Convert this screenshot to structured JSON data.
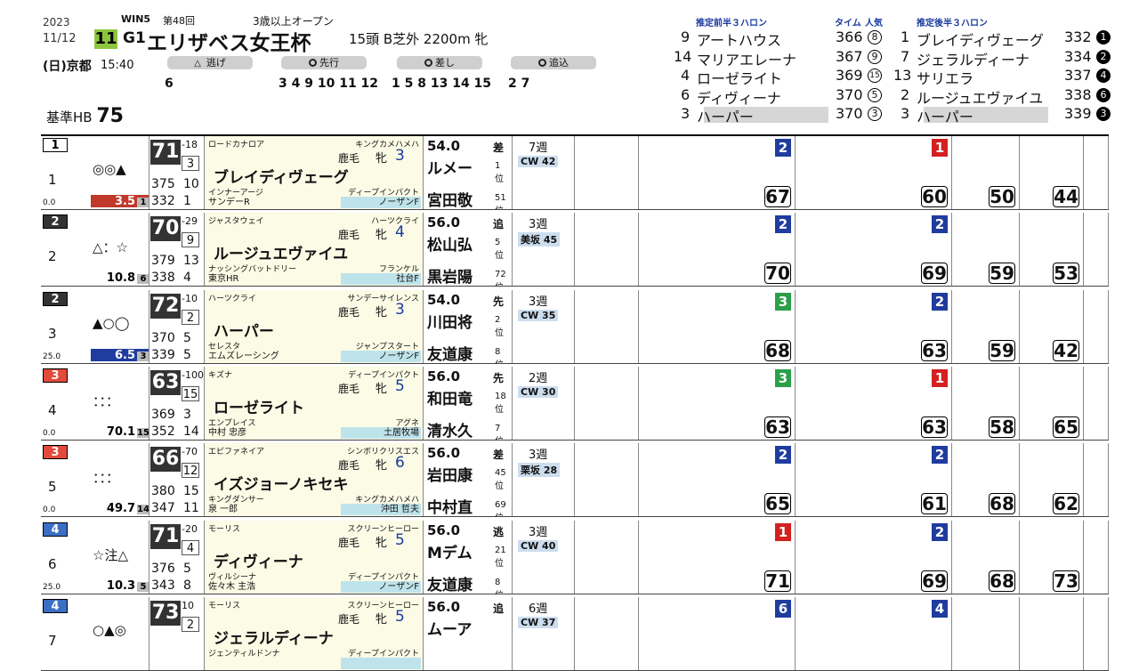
{
  "header": {
    "year": "2023",
    "date": "11/12",
    "race_no": "11",
    "win5": "WIN5",
    "kai": "第48回",
    "grade": "G1",
    "race_name": "エリザベス女王杯",
    "condition": "3歳以上オープン",
    "field": "15頭 B芝外 2200m 牝",
    "day": "(日)",
    "course": "京都",
    "time": "15:40",
    "kijun_label": "基準HB",
    "kijun_value": "75"
  },
  "running_styles": [
    {
      "label": "逃げ",
      "nums": "6"
    },
    {
      "label": "先行",
      "nums": "3 4 9 10 11 12"
    },
    {
      "label": "差し",
      "nums": "1 5 8 13 14 15"
    },
    {
      "label": "追込",
      "nums": "2 7"
    }
  ],
  "pace": {
    "front_title": "推定前半３ハロン",
    "time_title": "タイム",
    "pop_title": "人気",
    "back_title": "推定後半３ハロン",
    "front": [
      {
        "no": "9",
        "name": "アートハウス",
        "time": "366",
        "pop": "8"
      },
      {
        "no": "14",
        "name": "マリアエレーナ",
        "time": "367",
        "pop": "9"
      },
      {
        "no": "4",
        "name": "ローゼライト",
        "time": "369",
        "pop": "15"
      },
      {
        "no": "6",
        "name": "ディヴィーナ",
        "time": "370",
        "pop": "5"
      },
      {
        "no": "3",
        "name": "ハーパー",
        "time": "370",
        "pop": "3"
      }
    ],
    "back": [
      {
        "no": "1",
        "name": "ブレイディヴェーグ",
        "time": "332",
        "pop": "1"
      },
      {
        "no": "7",
        "name": "ジェラルディーナ",
        "time": "334",
        "pop": "2"
      },
      {
        "no": "13",
        "name": "サリエラ",
        "time": "337",
        "pop": "4"
      },
      {
        "no": "2",
        "name": "ルージュエヴァイユ",
        "time": "338",
        "pop": "6"
      },
      {
        "no": "3",
        "name": "ハーパー",
        "time": "339",
        "pop": "3"
      }
    ]
  },
  "horses": [
    {
      "waku": "1",
      "waku_color": "#ffffff",
      "waku_text": "#000",
      "no": "1",
      "marks": "◎◎▲",
      "weight_change": "0.0",
      "odds": "3.5",
      "pop": "1",
      "odds_bg": "#c0392b",
      "index": "71",
      "diff": "-18",
      "pop_box": "3",
      "n1": "375",
      "n2": "10",
      "n3": "332",
      "n4": "1",
      "sire": "ロードカナロア",
      "dam_sire_top": "キングカメハメハ",
      "coat": "鹿毛",
      "sex": "牝",
      "age": "3",
      "name": "ブレイディヴェーグ",
      "dam": "インナーアージ",
      "dam_sire": "ディープインパクト",
      "owner": "サンデーR",
      "breeder": "ノーザンF",
      "kin": "54.0",
      "style": "差",
      "jockey": "ルメー",
      "j_pos": "1",
      "trainer": "宮田敬",
      "t_pos": "51",
      "weeks": "7週",
      "cw": "CW 42",
      "score1": "67",
      "score2": "60",
      "rank1": "2",
      "rank2": "1",
      "last1": "50",
      "last2": "44"
    },
    {
      "waku": "2",
      "waku_color": "#333333",
      "waku_text": "#fff",
      "no": "2",
      "marks": "△：☆",
      "weight_change": "",
      "odds": "10.8",
      "pop": "6",
      "odds_bg": "#ffffff",
      "index": "70",
      "diff": "-29",
      "pop_box": "9",
      "n1": "379",
      "n2": "13",
      "n3": "338",
      "n4": "4",
      "sire": "ジャスタウェイ",
      "dam_sire_top": "ハーツクライ",
      "coat": "鹿毛",
      "sex": "牝",
      "age": "4",
      "name": "ルージュエヴァイユ",
      "dam": "ナッシングバットドリー",
      "dam_sire": "フランケル",
      "owner": "東京HR",
      "breeder": "社台F",
      "kin": "56.0",
      "style": "追",
      "jockey": "松山弘",
      "j_pos": "5",
      "trainer": "黒岩陽",
      "t_pos": "72",
      "weeks": "3週",
      "cw": "美坂 45",
      "score1": "70",
      "score2": "69",
      "rank1": "2",
      "rank2": "2",
      "last1": "59",
      "last2": "53"
    },
    {
      "waku": "2",
      "waku_color": "#333333",
      "waku_text": "#fff",
      "no": "3",
      "marks": "▲○◯",
      "weight_change": "25.0",
      "odds": "6.5",
      "pop": "3",
      "odds_bg": "#1f3c9e",
      "index": "72",
      "diff": "-10",
      "pop_box": "2",
      "n1": "370",
      "n2": "5",
      "n3": "339",
      "n4": "5",
      "sire": "ハーツクライ",
      "dam_sire_top": "サンデーサイレンス",
      "coat": "鹿毛",
      "sex": "牝",
      "age": "3",
      "name": "ハーパー",
      "dam": "セレスタ",
      "dam_sire": "ジャンプスタート",
      "owner": "エムズレーシング",
      "breeder": "ノーザンF",
      "kin": "54.0",
      "style": "先",
      "jockey": "川田将",
      "j_pos": "2",
      "trainer": "友道康",
      "t_pos": "8",
      "weeks": "3週",
      "cw": "CW 35",
      "score1": "68",
      "score2": "63",
      "rank1": "3",
      "rank2": "2",
      "last1": "59",
      "last2": "42"
    },
    {
      "waku": "3",
      "waku_color": "#e24a3b",
      "waku_text": "#fff",
      "no": "4",
      "marks": "：：：",
      "weight_change": "0.0",
      "odds": "70.1",
      "pop": "15",
      "odds_bg": "#ffffff",
      "index": "63",
      "diff": "-100",
      "pop_box": "15",
      "n1": "369",
      "n2": "3",
      "n3": "352",
      "n4": "14",
      "sire": "キズナ",
      "dam_sire_top": "ディープインパクト",
      "coat": "鹿毛",
      "sex": "牝",
      "age": "5",
      "name": "ローゼライト",
      "dam": "エンプレイス",
      "dam_sire": "アグネ",
      "owner": "中村 忠彦",
      "breeder": "土居牧場",
      "kin": "56.0",
      "style": "先",
      "jockey": "和田竜",
      "j_pos": "18",
      "trainer": "清水久",
      "t_pos": "7",
      "weeks": "2週",
      "cw": "CW 30",
      "score1": "63",
      "score2": "63",
      "rank1": "3",
      "rank2": "1",
      "last1": "58",
      "last2": "65"
    },
    {
      "waku": "3",
      "waku_color": "#e24a3b",
      "waku_text": "#fff",
      "no": "5",
      "marks": "：：：",
      "weight_change": "0.0",
      "odds": "49.7",
      "pop": "14",
      "odds_bg": "#ffffff",
      "index": "66",
      "diff": "-70",
      "pop_box": "12",
      "n1": "380",
      "n2": "15",
      "n3": "347",
      "n4": "11",
      "sire": "エピファネイア",
      "dam_sire_top": "シンボリクリスエス",
      "coat": "鹿毛",
      "sex": "牝",
      "age": "6",
      "name": "イズジョーノキセキ",
      "dam": "キングダンサー",
      "dam_sire": "キングカメハメハ",
      "owner": "泉 一郎",
      "breeder": "沖田 哲夫",
      "kin": "56.0",
      "style": "差",
      "jockey": "岩田康",
      "j_pos": "45",
      "trainer": "中村直",
      "t_pos": "69",
      "weeks": "3週",
      "cw": "栗坂 28",
      "score1": "65",
      "score2": "61",
      "rank1": "2",
      "rank2": "2",
      "last1": "68",
      "last2": "62"
    },
    {
      "waku": "4",
      "waku_color": "#3b6fc4",
      "waku_text": "#fff",
      "no": "6",
      "marks": "☆注△",
      "weight_change": "25.0",
      "odds": "10.3",
      "pop": "5",
      "odds_bg": "#ffffff",
      "index": "71",
      "diff": "-20",
      "pop_box": "4",
      "n1": "376",
      "n2": "5",
      "n3": "343",
      "n4": "8",
      "sire": "モーリス",
      "dam_sire_top": "スクリーンヒーロー",
      "coat": "鹿毛",
      "sex": "牝",
      "age": "5",
      "name": "ディヴィーナ",
      "dam": "ヴィルシーナ",
      "dam_sire": "ディープインパクト",
      "owner": "佐々木 主浩",
      "breeder": "ノーザンF",
      "kin": "56.0",
      "style": "逃",
      "jockey": "Mデム",
      "j_pos": "21",
      "trainer": "友道康",
      "t_pos": "8",
      "weeks": "3週",
      "cw": "CW 40",
      "score1": "71",
      "score2": "69",
      "rank1": "1",
      "rank2": "2",
      "last1": "68",
      "last2": "73"
    },
    {
      "waku": "4",
      "waku_color": "#3b6fc4",
      "waku_text": "#fff",
      "no": "7",
      "marks": "○▲◎",
      "weight_change": "",
      "odds": "",
      "pop": "",
      "odds_bg": "#ffffff",
      "index": "73",
      "diff": "10",
      "pop_box": "2",
      "n1": "",
      "n2": "",
      "n3": "",
      "n4": "",
      "sire": "モーリス",
      "dam_sire_top": "スクリーンヒーロー",
      "coat": "鹿毛",
      "sex": "牝",
      "age": "5",
      "name": "ジェラルディーナ",
      "dam": "ジェンティルドンナ",
      "dam_sire": "ディープインパクト",
      "owner": "",
      "breeder": "",
      "kin": "56.0",
      "style": "追",
      "jockey": "ムーア",
      "j_pos": "",
      "trainer": "",
      "t_pos": "",
      "weeks": "6週",
      "cw": "CW 37",
      "score1": "",
      "score2": "",
      "rank1": "6",
      "rank2": "4",
      "last1": "",
      "last2": ""
    }
  ]
}
